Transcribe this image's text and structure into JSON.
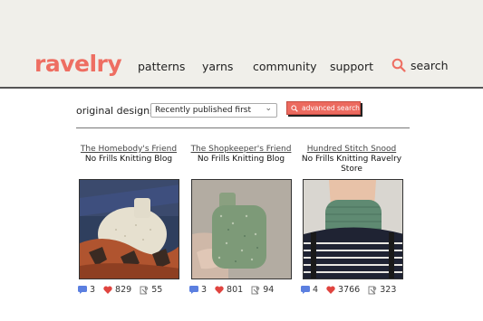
{
  "header": {
    "logo": "ravelry",
    "nav": [
      {
        "label": "patterns"
      },
      {
        "label": "yarns"
      },
      {
        "label": "community"
      },
      {
        "label": "support"
      }
    ],
    "search_label": "search"
  },
  "filters": {
    "label": "original designs",
    "sort_selected": "Recently published first",
    "advanced_search": "advanced search"
  },
  "cards": [
    {
      "title": "The Homebody's Friend",
      "author": "No Frills Knitting Blog",
      "comments": "3",
      "hearts": "829",
      "projects": "55"
    },
    {
      "title": "The Shopkeeper's Friend",
      "author": "No Frills Knitting Blog",
      "comments": "3",
      "hearts": "801",
      "projects": "94"
    },
    {
      "title": "Hundred Stitch Snood",
      "author": "No Frills Knitting Ravelry Store",
      "comments": "4",
      "hearts": "3766",
      "projects": "323"
    }
  ],
  "colors": {
    "brand": "#ee6e62",
    "comment_icon": "#5b7fe0",
    "heart_icon": "#e0443f"
  }
}
